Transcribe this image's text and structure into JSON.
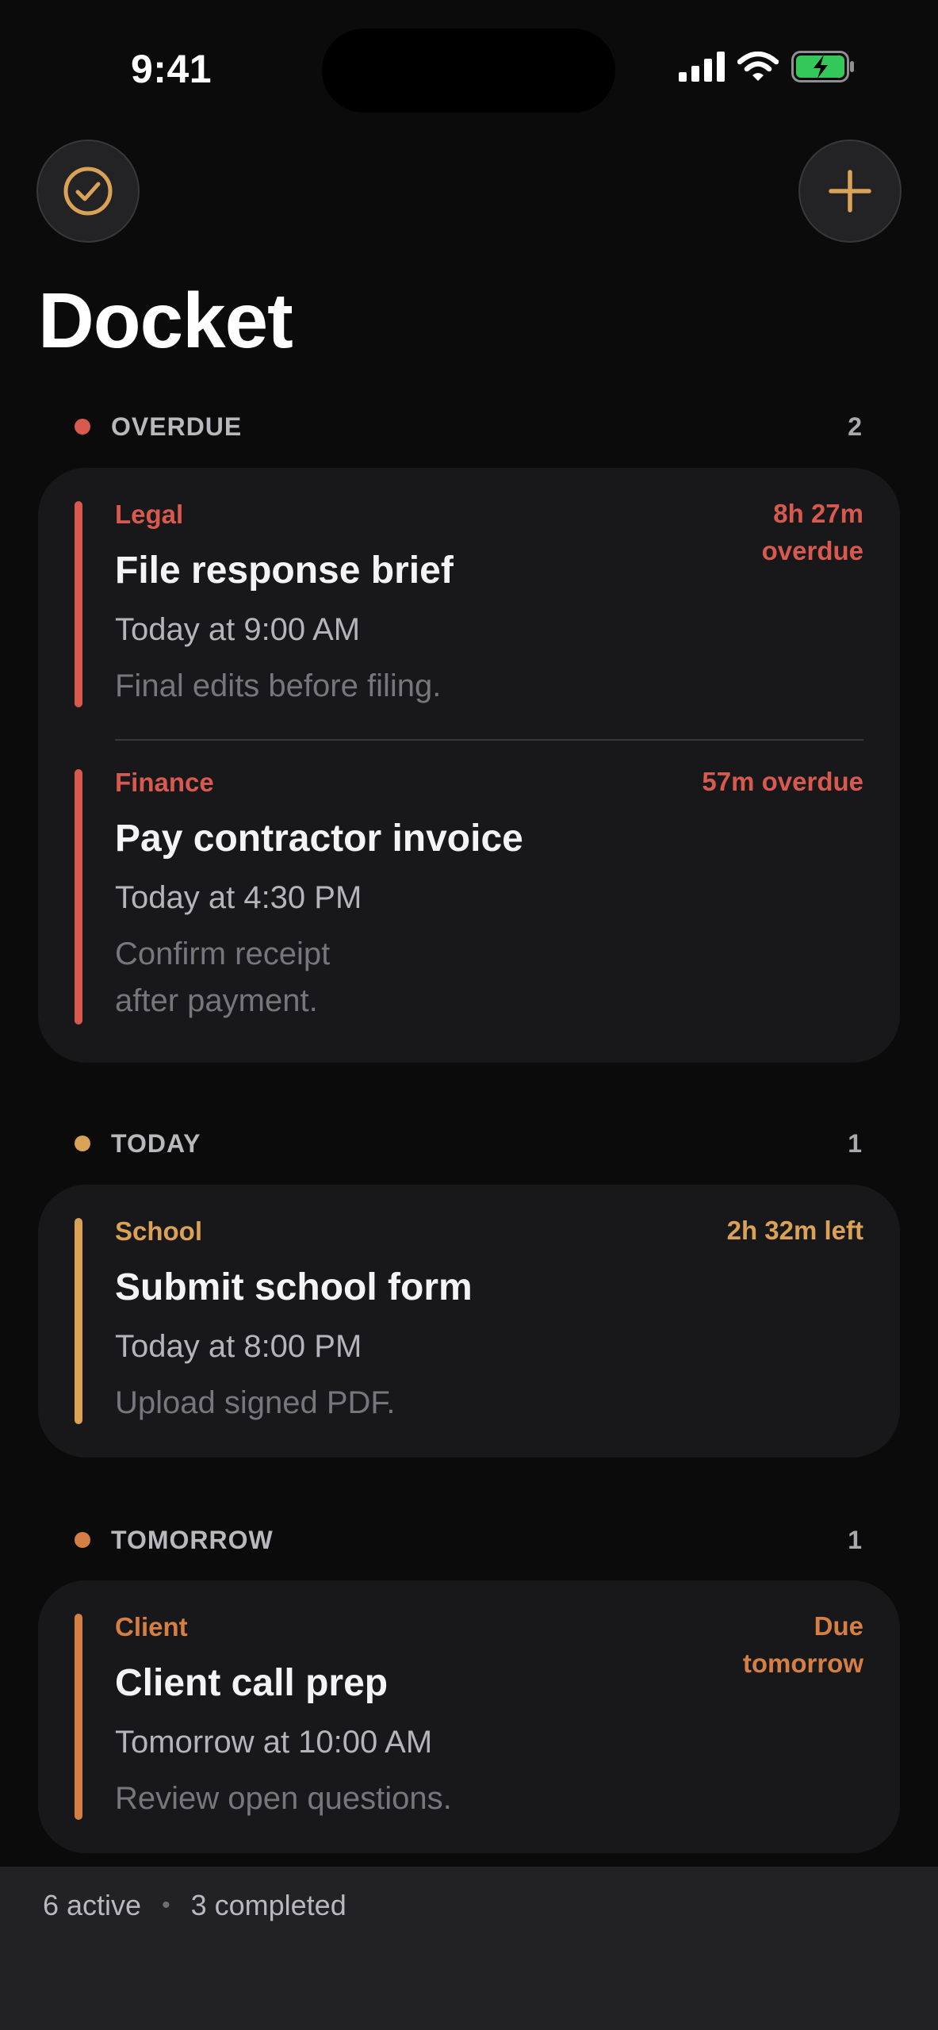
{
  "status_bar": {
    "time": "9:41"
  },
  "header": {
    "title": "Docket",
    "left_button_icon": "check-circle-icon",
    "right_button_icon": "plus-icon"
  },
  "colors": {
    "overdue": "#d85a4f",
    "today": "#d9a257",
    "tomorrow": "#d57f44"
  },
  "sections": {
    "overdue": {
      "label": "OVERDUE",
      "count": "2",
      "tasks": [
        {
          "category": "Legal",
          "status_line1": "8h 27m",
          "status_line2": "overdue",
          "title": "File response brief",
          "due": "Today at 9:00 AM",
          "note": "Final edits before filing."
        },
        {
          "category": "Finance",
          "status_line1": "57m overdue",
          "title": "Pay contractor invoice",
          "due": "Today at 4:30 PM",
          "note_line1": "Confirm receipt",
          "note_line2": "after payment."
        }
      ]
    },
    "today": {
      "label": "TODAY",
      "count": "1",
      "tasks": [
        {
          "category": "School",
          "status_line1": "2h 32m left",
          "title": "Submit school form",
          "due": "Today at 8:00 PM",
          "note": "Upload signed PDF."
        }
      ]
    },
    "tomorrow": {
      "label": "TOMORROW",
      "count": "1",
      "tasks": [
        {
          "category": "Client",
          "status_line1": "Due",
          "status_line2": "tomorrow",
          "title": "Client call prep",
          "due": "Tomorrow at 10:00 AM",
          "note": "Review open questions."
        }
      ]
    }
  },
  "footer": {
    "active": "6 active",
    "completed": "3 completed"
  }
}
